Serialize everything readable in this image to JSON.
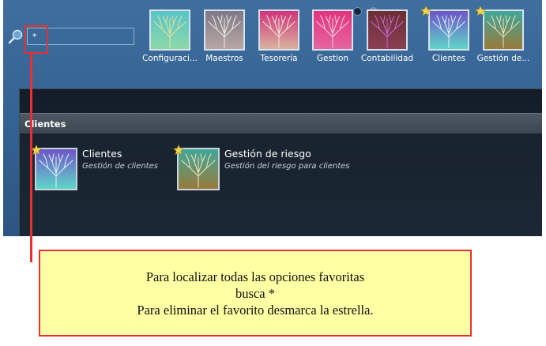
{
  "search": {
    "value": "*"
  },
  "top_tiles": [
    {
      "label": "Configuraci...",
      "icon": "tree-green-icon",
      "favorite": false
    },
    {
      "label": "Maestros",
      "icon": "tree-grey-icon",
      "favorite": false
    },
    {
      "label": "Tesorería",
      "icon": "tree-pink-icon",
      "favorite": false
    },
    {
      "label": "Gestion",
      "icon": "tree-magenta-icon",
      "favorite": false
    },
    {
      "label": "Contabilidad",
      "icon": "tree-brown-icon",
      "favorite": false
    },
    {
      "label": "Clientes",
      "icon": "tree-blue-icon",
      "favorite": true
    },
    {
      "label": "Gestión de...",
      "icon": "tree-olive-icon",
      "favorite": true
    }
  ],
  "section": {
    "title": "Clientes",
    "items": [
      {
        "title": "Clientes",
        "description": "Gestión de clientes",
        "icon": "tree-blue-icon",
        "favorite": true
      },
      {
        "title": "Gestión de riesgo",
        "description": "Gestión del riesgo para clientes",
        "icon": "tree-olive-icon",
        "favorite": true
      }
    ]
  },
  "callout": {
    "line1": "Para localizar todas las opciones favoritas",
    "line2": "busca *",
    "line3": "Para eliminar el favorito desmarca la estrella."
  },
  "colors": {
    "accent_red": "#e53131",
    "callout_bg": "#ffffa4",
    "app_blue": "#3a6a9a",
    "star_gold": "#f3d54e"
  }
}
